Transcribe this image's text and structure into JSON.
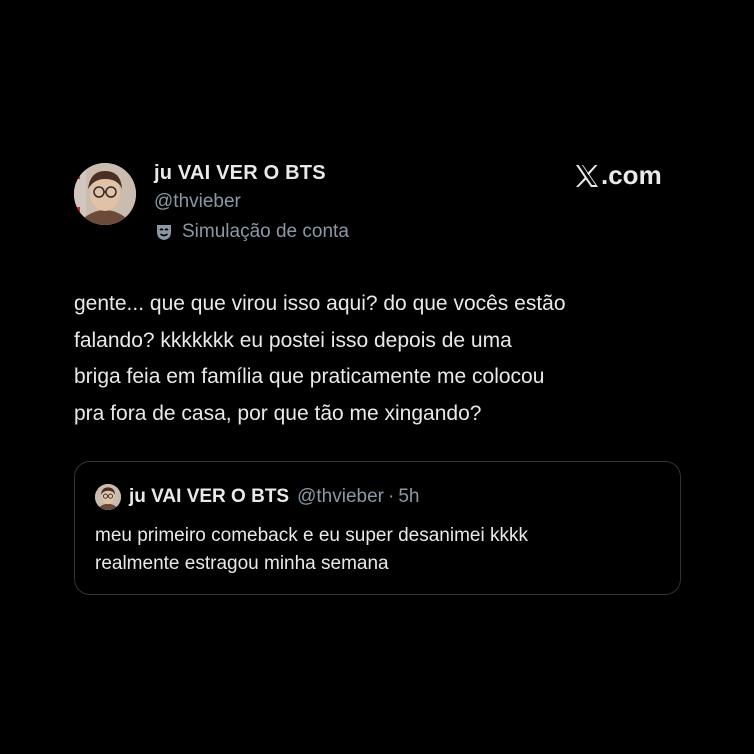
{
  "author": {
    "name": "ju VAI VER O BTS",
    "handle": "@thvieber",
    "badge_text": "Simulação de conta",
    "badge_icon": "theater-mask-icon",
    "avatar_icon": "profile-photo"
  },
  "brand": {
    "text": ".com",
    "icon": "x-logo-icon"
  },
  "tweet": {
    "lines": [
      "gente... que que virou isso aqui? do que vocês estão",
      "falando? kkkkkkk eu postei isso depois de uma",
      "briga feia em família que praticamente me colocou",
      "pra fora de casa, por que tão me xingando?"
    ]
  },
  "quoted": {
    "name": "ju VAI VER O BTS",
    "handle": "@thvieber",
    "separator": "·",
    "time": "5h",
    "lines": [
      "meu primeiro comeback e eu super desanimei kkkk",
      "realmente estragou minha semana"
    ]
  },
  "colors": {
    "background": "#000000",
    "text": "#e7e9ea",
    "muted": "#8b98a5",
    "border": "#2f3336"
  }
}
